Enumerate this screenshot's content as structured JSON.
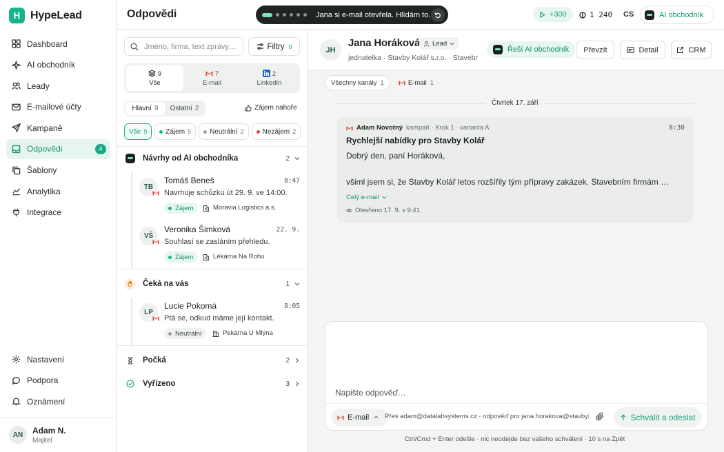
{
  "app": {
    "name": "HypeLead",
    "logo_letter": "H"
  },
  "sidebar": {
    "items": [
      {
        "label": "Dashboard",
        "icon": "grid-icon"
      },
      {
        "label": "AI obchodník",
        "icon": "sparkle-icon"
      },
      {
        "label": "Leady",
        "icon": "users-icon"
      },
      {
        "label": "E-mailové účty",
        "icon": "mail-icon"
      },
      {
        "label": "Kampaně",
        "icon": "send-icon"
      },
      {
        "label": "Odpovědi",
        "icon": "inbox-icon",
        "active": true,
        "badge": "4"
      },
      {
        "label": "Šablony",
        "icon": "copy-icon"
      },
      {
        "label": "Analytika",
        "icon": "chart-icon"
      },
      {
        "label": "Integrace",
        "icon": "plug-icon"
      }
    ],
    "bottom_items": [
      {
        "label": "Nastavení",
        "icon": "gear-icon"
      },
      {
        "label": "Podpora",
        "icon": "chat-icon"
      },
      {
        "label": "Oznámení",
        "icon": "bell-icon"
      }
    ],
    "user": {
      "initials": "AN",
      "name": "Adam N.",
      "role": "Majitel"
    }
  },
  "topbar": {
    "title": "Odpovědi",
    "toast": "Jana si e-mail otevřela. Hlídám to.",
    "credits": "+300",
    "balance": "1 240",
    "lang": "CS",
    "ai_button": "AI obchodník"
  },
  "list": {
    "search_placeholder": "Jméno, firma, text zprávy…",
    "filters_label": "Filtry",
    "filters_count": "0",
    "channels": [
      {
        "label": "Vše",
        "count": "9",
        "active": true
      },
      {
        "label": "E-mail",
        "count": "7"
      },
      {
        "label": "LinkedIn",
        "count": "2"
      }
    ],
    "main_tabs": [
      {
        "label": "Hlavní",
        "count": "9",
        "active": true
      },
      {
        "label": "Ostatní",
        "count": "2"
      }
    ],
    "interest_top": "Zájem nahoře",
    "status_chips": [
      {
        "label": "Vše",
        "count": "9",
        "active": true,
        "color": ""
      },
      {
        "label": "Zájem",
        "count": "5",
        "color": "#17b38a"
      },
      {
        "label": "Neutrální",
        "count": "2",
        "color": "#9aa09c"
      },
      {
        "label": "Nezájem",
        "count": "2",
        "color": "#e0443e"
      }
    ],
    "groups": [
      {
        "title": "Návrhy od AI obchodníka",
        "count": "2"
      },
      {
        "title": "Čeká na vás",
        "count": "1"
      },
      {
        "title": "Počká",
        "count": "2"
      },
      {
        "title": "Vyřízeno",
        "count": "3"
      }
    ],
    "threads": [
      {
        "initials": "TB",
        "name": "Tomáš Beneš",
        "time": "8:47",
        "message": "Navrhuje schůzku út 29. 9. ve 14:00.",
        "tag": "Zájem",
        "company": "Moravia Logistics a.s."
      },
      {
        "initials": "VŠ",
        "name": "Veronika Šimková",
        "time": "22. 9.",
        "message": "Souhlasí se zasláním přehledu.",
        "tag": "Zájem",
        "company": "Lékárna Na Rohu"
      },
      {
        "initials": "LP",
        "name": "Lucie Pokomá",
        "time": "8:05",
        "message": "Ptá se, odkud máme její kontakt.",
        "tag": "Neutrální",
        "company": "Pekárna U Mlýna"
      }
    ]
  },
  "lead": {
    "initials": "JH",
    "name": "Jana Horáková",
    "badge": "Lead",
    "subtitle": "jednatelka · Stavby Kolář s.r.o. · Stavebnictví",
    "ai_status": "Řeší AI obchodník",
    "take_over": "Převzít",
    "detail": "Detail",
    "crm": "CRM",
    "channel_tabs": [
      {
        "label": "Všechny kanály",
        "count": "1",
        "active": true
      },
      {
        "label": "E-mail",
        "count": "1"
      }
    ],
    "day": "Čtvrtek 17. září"
  },
  "message": {
    "from": "Adam Novotný",
    "meta": "kampaň · Krok 1 · varianta A",
    "time": "8:30",
    "subject": "Rychlejší nabídky pro Stavby Kolář",
    "greeting": "Dobrý den, paní Horáková,",
    "body": "všiml jsem si, že Stavby Kolář letos rozšířily tým přípravy zakázek. Stavebním firmám …",
    "full_email": "Celý e-mail",
    "opened": "Otevřeno 17. 9. v 9:41"
  },
  "composer": {
    "placeholder": "Napište odpověď…",
    "channel": "E-mail",
    "via": "Přes adam@datalabsystems.cz · odpověď pro jana.horakova@stavbykolar.cz",
    "send": "Schválit a odeslat",
    "hint": "Ctrl/Cmd + Enter odešle · nic neodejde bez vašeho schválení · 10 s na Zpět"
  }
}
